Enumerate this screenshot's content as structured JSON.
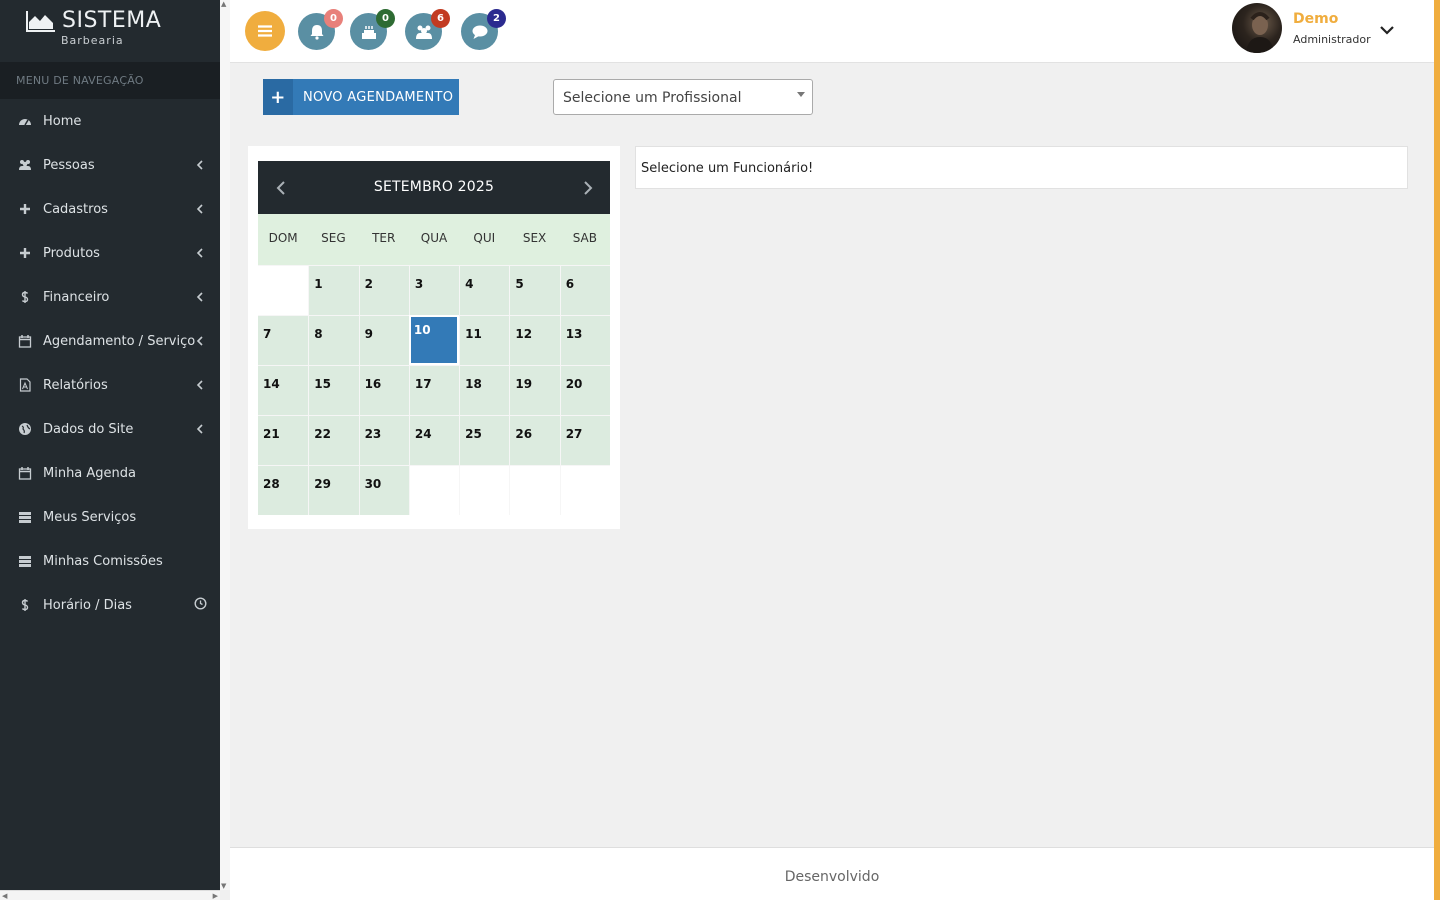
{
  "brand": {
    "title": "SISTEMA",
    "subtitle": "Barbearia"
  },
  "nav": {
    "header": "MENU DE NAVEGAÇÃO",
    "items": [
      {
        "label": "Home",
        "icon": "dashboard-icon"
      },
      {
        "label": "Pessoas",
        "icon": "users-icon"
      },
      {
        "label": "Cadastros",
        "icon": "plus-icon"
      },
      {
        "label": "Produtos",
        "icon": "plus-icon"
      },
      {
        "label": "Financeiro",
        "icon": "dollar-icon"
      },
      {
        "label": "Agendamento / Serviço",
        "icon": "calendar-icon"
      },
      {
        "label": "Relatórios",
        "icon": "file-pdf-icon"
      },
      {
        "label": "Dados do Site",
        "icon": "globe-icon"
      },
      {
        "label": "Minha Agenda",
        "icon": "calendar-icon"
      },
      {
        "label": "Meus Serviços",
        "icon": "server-icon"
      },
      {
        "label": "Minhas Comissões",
        "icon": "server-icon"
      },
      {
        "label": "Horário / Dias",
        "icon": "dollar-icon"
      }
    ]
  },
  "topbar": {
    "notifications": [
      {
        "icon": "bell-icon",
        "count": "0",
        "badge_color": "#e8807a"
      },
      {
        "icon": "birthday-cake-icon",
        "count": "0",
        "badge_color": "#2e6b33"
      },
      {
        "icon": "users-icon",
        "count": "6",
        "badge_color": "#c23b22"
      },
      {
        "icon": "comment-icon",
        "count": "2",
        "badge_color": "#2b2a8f"
      }
    ],
    "user": {
      "name": "Demo",
      "role": "Administrador"
    }
  },
  "toolbar": {
    "new_label": "NOVO AGENDAMENTO",
    "select_placeholder": "Selecione um Profissional"
  },
  "calendar": {
    "title": "SETEMBRO 2025",
    "weekdays": [
      "DOM",
      "SEG",
      "TER",
      "QUA",
      "QUI",
      "SEX",
      "SAB"
    ],
    "weeks": [
      [
        "",
        "1",
        "2",
        "3",
        "4",
        "5",
        "6"
      ],
      [
        "7",
        "8",
        "9",
        "10",
        "11",
        "12",
        "13"
      ],
      [
        "14",
        "15",
        "16",
        "17",
        "18",
        "19",
        "20"
      ],
      [
        "21",
        "22",
        "23",
        "24",
        "25",
        "26",
        "27"
      ],
      [
        "28",
        "29",
        "30",
        "",
        "",
        "",
        ""
      ]
    ],
    "today": "10"
  },
  "info": {
    "message": "Selecione um Funcionário!"
  },
  "footer": {
    "text": "Desenvolvido"
  },
  "colors": {
    "accent": "#f0ad3e",
    "primary": "#337ab7",
    "sidebar": "#232a2f",
    "calendar_cell": "#dcebdf"
  }
}
